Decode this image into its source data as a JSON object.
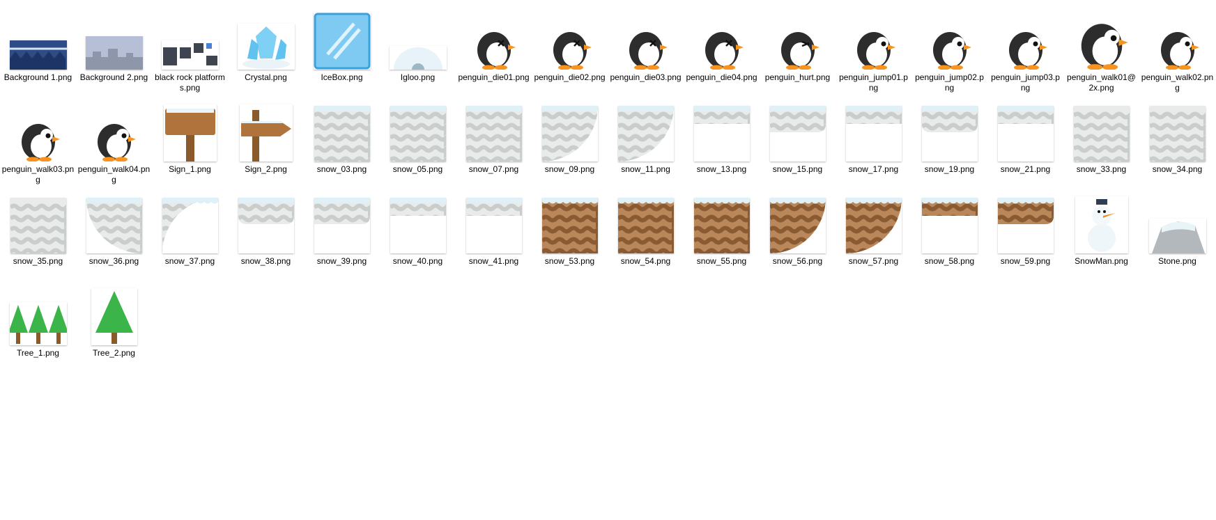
{
  "files": [
    {
      "name": "Background 1.png",
      "icon": "background-night-icon"
    },
    {
      "name": "Background 2.png",
      "icon": "background-day-icon"
    },
    {
      "name": "black rock platforms.png",
      "icon": "rock-platforms-icon"
    },
    {
      "name": "Crystal.png",
      "icon": "crystal-icon"
    },
    {
      "name": "IceBox.png",
      "icon": "icebox-icon"
    },
    {
      "name": "Igloo.png",
      "icon": "igloo-icon"
    },
    {
      "name": "penguin_die01.png",
      "icon": "penguin-icon"
    },
    {
      "name": "penguin_die02.png",
      "icon": "penguin-icon"
    },
    {
      "name": "penguin_die03.png",
      "icon": "penguin-icon"
    },
    {
      "name": "penguin_die04.png",
      "icon": "penguin-icon"
    },
    {
      "name": "penguin_hurt.png",
      "icon": "penguin-icon"
    },
    {
      "name": "penguin_jump01.png",
      "icon": "penguin-icon"
    },
    {
      "name": "penguin_jump02.png",
      "icon": "penguin-icon"
    },
    {
      "name": "penguin_jump03.png",
      "icon": "penguin-icon"
    },
    {
      "name": "penguin_walk01@2x.png",
      "icon": "penguin-icon"
    },
    {
      "name": "penguin_walk02.png",
      "icon": "penguin-icon"
    },
    {
      "name": "penguin_walk03.png",
      "icon": "penguin-icon"
    },
    {
      "name": "penguin_walk04.png",
      "icon": "penguin-icon"
    },
    {
      "name": "Sign_1.png",
      "icon": "wooden-sign-icon"
    },
    {
      "name": "Sign_2.png",
      "icon": "arrow-sign-icon"
    },
    {
      "name": "snow_03.png",
      "icon": "snow-tile-icon"
    },
    {
      "name": "snow_05.png",
      "icon": "snow-tile-icon"
    },
    {
      "name": "snow_07.png",
      "icon": "snow-tile-icon"
    },
    {
      "name": "snow_09.png",
      "icon": "snow-tile-icon"
    },
    {
      "name": "snow_11.png",
      "icon": "snow-tile-icon"
    },
    {
      "name": "snow_13.png",
      "icon": "snow-tile-icon"
    },
    {
      "name": "snow_15.png",
      "icon": "snow-tile-icon"
    },
    {
      "name": "snow_17.png",
      "icon": "snow-tile-icon"
    },
    {
      "name": "snow_19.png",
      "icon": "snow-tile-icon"
    },
    {
      "name": "snow_21.png",
      "icon": "snow-tile-icon"
    },
    {
      "name": "snow_33.png",
      "icon": "snow-tile-icon"
    },
    {
      "name": "snow_34.png",
      "icon": "snow-tile-icon"
    },
    {
      "name": "snow_35.png",
      "icon": "snow-tile-icon"
    },
    {
      "name": "snow_36.png",
      "icon": "snow-tile-icon"
    },
    {
      "name": "snow_37.png",
      "icon": "snow-tile-icon"
    },
    {
      "name": "snow_38.png",
      "icon": "snow-tile-icon"
    },
    {
      "name": "snow_39.png",
      "icon": "snow-tile-icon"
    },
    {
      "name": "snow_40.png",
      "icon": "snow-tile-icon"
    },
    {
      "name": "snow_41.png",
      "icon": "snow-tile-icon"
    },
    {
      "name": "snow_53.png",
      "icon": "dirt-tile-icon"
    },
    {
      "name": "snow_54.png",
      "icon": "dirt-tile-icon"
    },
    {
      "name": "snow_55.png",
      "icon": "dirt-tile-icon"
    },
    {
      "name": "snow_56.png",
      "icon": "dirt-tile-icon"
    },
    {
      "name": "snow_57.png",
      "icon": "dirt-tile-icon"
    },
    {
      "name": "snow_58.png",
      "icon": "dirt-tile-icon"
    },
    {
      "name": "snow_59.png",
      "icon": "dirt-tile-icon"
    },
    {
      "name": "SnowMan.png",
      "icon": "snowman-icon"
    },
    {
      "name": "Stone.png",
      "icon": "stone-icon"
    },
    {
      "name": "Tree_1.png",
      "icon": "trees-icon"
    },
    {
      "name": "Tree_2.png",
      "icon": "tree-icon"
    }
  ],
  "colors": {
    "label": "#000000",
    "snow_wave": "#c9cdcc",
    "snow_light": "#e8ebea",
    "snow_cap": "#dff1f6",
    "dirt_dark": "#8a5a33",
    "dirt_light": "#b9875a",
    "penguin_body": "#2d2d2d",
    "penguin_beak": "#f79420",
    "ice": "#7fd0f5",
    "tree": "#3bb54a"
  }
}
